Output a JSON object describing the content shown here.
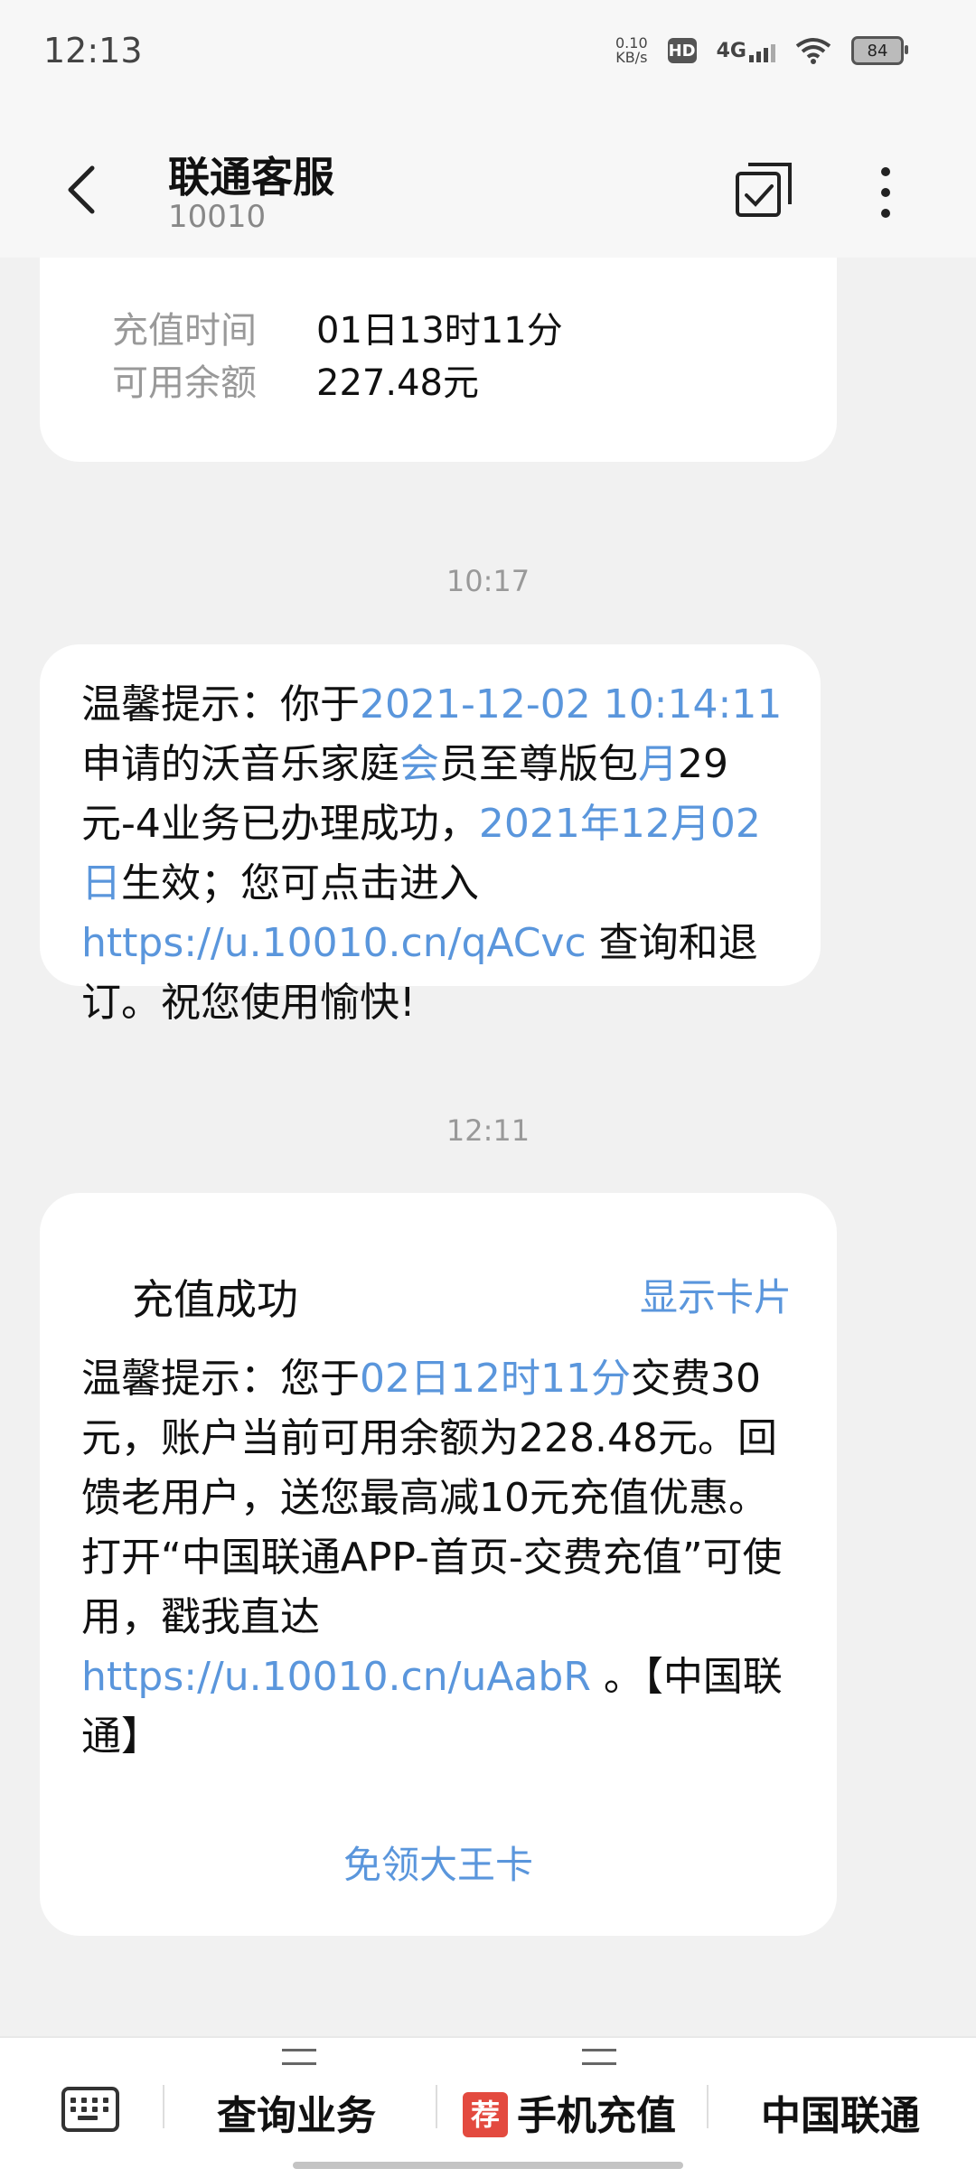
{
  "status_bar": {
    "time": "12:13",
    "net_speed_value": "0.10",
    "net_speed_unit": "KB/s",
    "hd_label": "HD",
    "network_label": "4G",
    "battery_level": "84"
  },
  "header": {
    "title": "联通客服",
    "subtitle": "10010"
  },
  "messages": {
    "recharge_record": {
      "fields": [
        {
          "label": "充值时间",
          "value": "01日13时11分"
        },
        {
          "label": "可用余额",
          "value": "227.48元"
        }
      ]
    },
    "timestamp_1": "10:17",
    "notice_1": {
      "p1": "温馨提示：你于",
      "link_datetime": "2021-12-02 10:14:11",
      "p2": "申请的沃音乐家庭",
      "link_hui": "会",
      "p3": "员至尊版包",
      "link_yue": "月",
      "p4": "29元-4业务已办理成功，",
      "link_date": "2021年12月02日",
      "p5": "生效；您可点击进入",
      "link_url": "https://u.10010.cn/qACvc",
      "p6": "查询和退订。祝您使用愉快!"
    },
    "timestamp_2": "12:11",
    "recharge_card": {
      "title": "充值成功",
      "action": "显示卡片",
      "p1": "温馨提示：您于",
      "link_time": "02日12时11分",
      "p2": "交费30元，账户当前可用余额为228.48元。回馈老用户，送您最高减10元充值优惠。打开“中国联通APP-首页-交费充值”可使用，戳我直达",
      "link_url": "https://u.10010.cn/uAabR",
      "p3": "。【中国联通】",
      "footer_action": "免领大王卡"
    }
  },
  "bottom_menu": {
    "items": [
      {
        "label": "查询业务"
      },
      {
        "label": "手机充值",
        "badge": "荐"
      },
      {
        "label": "中国联通"
      }
    ]
  }
}
